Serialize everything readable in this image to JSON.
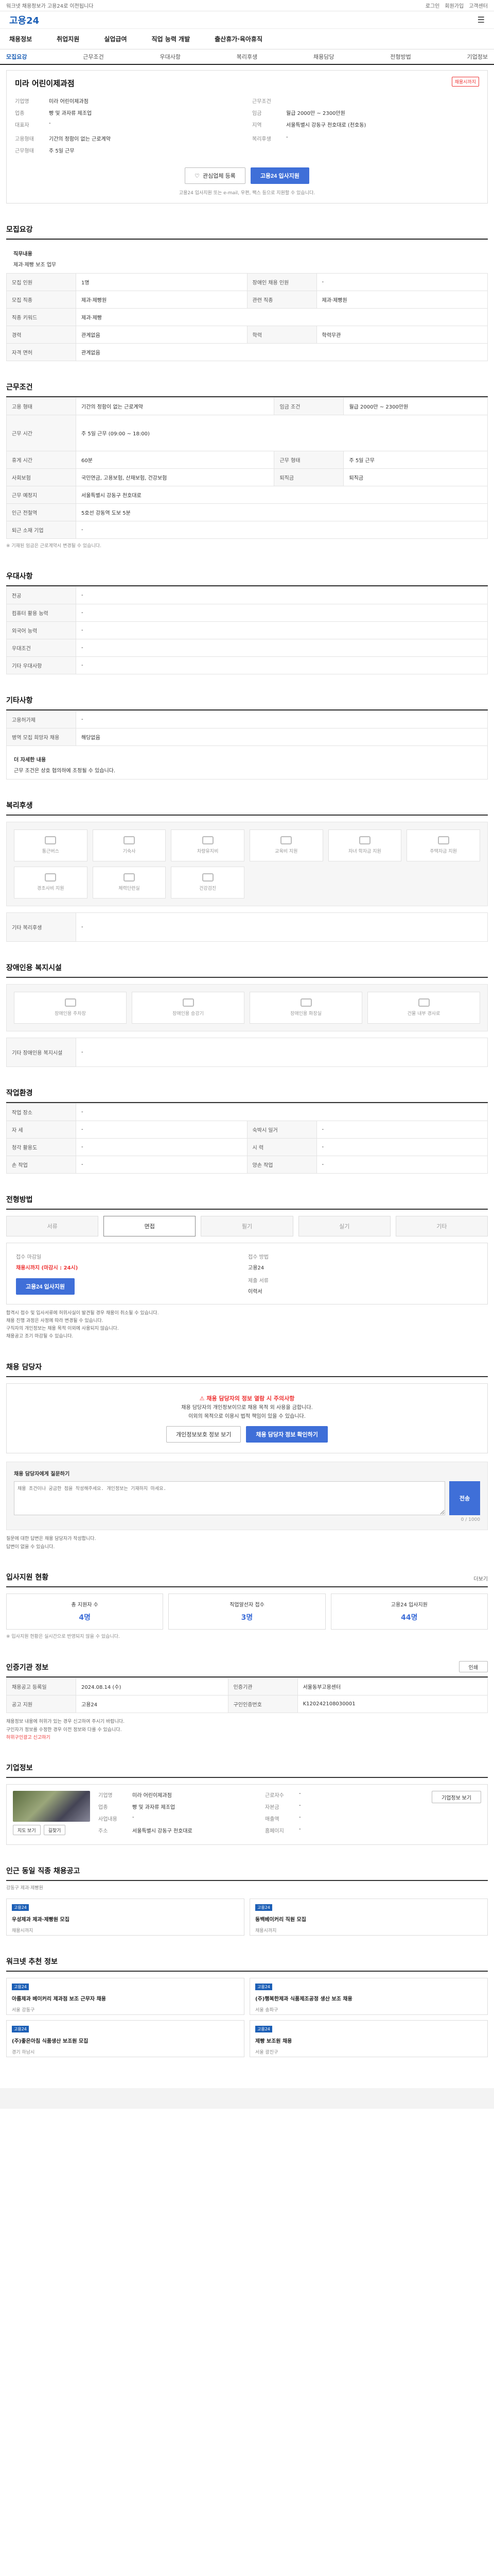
{
  "topbar": {
    "left": "워크넷 채용정보가 고용24로 이전됩니다",
    "links": [
      "로그인",
      "회원가입",
      "고객센터"
    ]
  },
  "logo": "고용24",
  "gnb": [
    "채용정보",
    "취업지원",
    "실업급여",
    "직업 능력 개발",
    "출산휴가·육아휴직"
  ],
  "subnav": {
    "items": [
      "모집요강",
      "근무조건",
      "우대사항",
      "복리후생",
      "채용담당",
      "전형방법",
      "기업정보"
    ],
    "active": 0
  },
  "job": {
    "title": "미라 어린이제과점",
    "badge": "채용시까지",
    "left_group": [
      {
        "k": "기업명",
        "v": "미라 어린이제과점"
      },
      {
        "k": "업종",
        "v": "빵 및 과자류 제조업"
      },
      {
        "k": "대표자",
        "v": "-"
      }
    ],
    "right_group": [
      {
        "k": "근무조건",
        "v": ""
      },
      {
        "k": "임금",
        "v": "월급 2000만 ~ 2300만원"
      },
      {
        "k": "지역",
        "v": "서울특별시 강동구 천호대로 (천호동)"
      }
    ],
    "left2": [
      {
        "k": "고용형태",
        "v": "기간의 정함이 없는 근로계약"
      },
      {
        "k": "근무형태",
        "v": "주 5일 근무"
      }
    ],
    "right2": [
      {
        "k": "복리후생",
        "v": "-"
      }
    ],
    "btn_scrap": "관심업체 등록",
    "btn_apply": "고용24 입사지원",
    "note": "고용24 입사지원 또는 e-mail, 우편, 팩스 등으로 지원할 수 있습니다."
  },
  "recruit": {
    "title": "모집요강",
    "job_title": "직무내용",
    "job_desc": "제과·제빵 보조 업무",
    "rows": [
      {
        "k1": "모집 인원",
        "v1": "1명",
        "k2": "장애인 채용 인원",
        "v2": "-"
      },
      {
        "k1": "모집 직종",
        "v1": "제과·제빵원",
        "k2": "관련 직종",
        "v2": "제과·제빵원"
      },
      {
        "k1": "직종 키워드",
        "v1": "제과·제빵",
        "k2": "",
        "v2": ""
      },
      {
        "k1": "경력",
        "v1": "관계없음",
        "k2": "학력",
        "v2": "학력무관"
      },
      {
        "k1": "자격 면허",
        "v1": "관계없음",
        "k2": "",
        "v2": ""
      }
    ]
  },
  "work": {
    "title": "근무조건",
    "rows": [
      {
        "k1": "고용 형태",
        "v1": "기간의 정함이 없는 근로계약",
        "k2": "임금 조건",
        "v2": "월급 2000만 ~ 2300만원"
      },
      {
        "k1": "근무 시간",
        "v1": "주 5일 근무 (09:00 ~ 18:00)",
        "k2": "",
        "v2": ""
      },
      {
        "k1": "휴게 시간",
        "v1": "60분",
        "k2": "근무 형태",
        "v2": "주 5일 근무"
      },
      {
        "k1": "사회보험",
        "v1": "국민연금, 고용보험, 산재보험, 건강보험",
        "k2": "퇴직금",
        "v2": "퇴직금"
      },
      {
        "k1": "근무 예정지",
        "v1": "서울특별시 강동구 천호대로",
        "k2": "",
        "v2": ""
      },
      {
        "k1": "인근 전철역",
        "v1": "5호선 강동역 도보 5분",
        "k2": "",
        "v2": ""
      },
      {
        "k1": "퇴근 소재 기업",
        "v1": "-",
        "k2": "",
        "v2": ""
      }
    ],
    "note": "※ 기재된 임금은 근로계약시 변경될 수 있습니다."
  },
  "prefer": {
    "title": "우대사항",
    "rows": [
      {
        "k": "전공",
        "v": "-"
      },
      {
        "k": "컴퓨터 활용 능력",
        "v": "-"
      },
      {
        "k": "외국어 능력",
        "v": "-"
      },
      {
        "k": "우대조건",
        "v": "-"
      },
      {
        "k": "기타 우대사항",
        "v": "-"
      }
    ]
  },
  "other": {
    "title": "기타사항",
    "rows": [
      {
        "k": "고용허가제",
        "v": "-"
      },
      {
        "k": "병역 모집 희망자 채용",
        "v": "해당없음"
      }
    ],
    "notice_title": "더 자세한 내용",
    "notice_desc": "근무 조건은 상호 협의하에 조정될 수 있습니다."
  },
  "welfare": {
    "title": "복리후생",
    "items": [
      "통근버스",
      "기숙사",
      "차량유지비",
      "교육비 지원",
      "자녀 학자금 지원",
      "주택자금 지원",
      "경조사비 지원",
      "체력단련실",
      "건강검진"
    ],
    "etc_label": "기타 복리후생",
    "etc_value": "-"
  },
  "disabled": {
    "title": "장애인용 복지시설",
    "items": [
      "장애인용 주차장",
      "장애인용 승강기",
      "장애인용 화장실",
      "건물 내부 경사로"
    ],
    "etc_label": "기타 장애인용 복지시설",
    "etc_value": "-"
  },
  "env": {
    "title": "작업환경",
    "rows": [
      {
        "k1": "작업 장소",
        "v1": "-",
        "k2": "",
        "v2": ""
      },
      {
        "k1": "자 세",
        "v1": "-",
        "k2": "숙박시 일거",
        "v2": "-"
      },
      {
        "k1": "청각 활용도",
        "v1": "-",
        "k2": "시 력",
        "v2": "-"
      },
      {
        "k1": "손 작업",
        "v1": "-",
        "k2": "양손 작업",
        "v2": "-"
      }
    ]
  },
  "screening": {
    "title": "전형방법",
    "steps": [
      "서류",
      "면접",
      "필기",
      "실기",
      "기타"
    ],
    "active": 1,
    "method_label": "접수 마감일",
    "method_value": "채용시까지 (마감시 : 24시)",
    "apply_label": "접수 방법",
    "apply_value": "고용24",
    "doc_label": "제출 서류",
    "doc_value": "이력서",
    "apply_btn": "고용24 입사지원",
    "bullets": [
      "합격시 접수 및 입사서류에 허위사실이 발견될 경우 채용이 취소될 수 있습니다.",
      "채용 진행 과정은 사정에 따라 변경될 수 있습니다.",
      "구직자의 개인정보는 채용 목적 이외에 사용되지 않습니다.",
      "채용공고 조기 마감될 수 있습니다."
    ]
  },
  "contact": {
    "title": "채용 담당자",
    "alert_title": "채용 담당자의 정보 열람 시 주의사항",
    "alert_lines": [
      "채용 담당자의 개인정보이므로 채용 목적 외 사용을 금합니다.",
      "이외의 목적으로 이용시 법적 책임이 있을 수 있습니다."
    ],
    "btn_view": "채용 담당자 정보 확인하기",
    "btn_report": "개인정보보호 정보 보기",
    "q_title": "채용 담당자에게 질문하기",
    "q_placeholder": "채용 조건이나 궁금한 점을 작성해주세요. 개인정보는 기재하지 마세요.",
    "q_count": "0 / 1000",
    "q_btn": "전송",
    "q_notes": [
      "질문에 대한 답변은 채용 담당자가 작성합니다.",
      "답변이 없을 수 있습니다."
    ]
  },
  "applicants": {
    "title": "입사지원 현황",
    "more": "더보기",
    "stats": [
      {
        "label": "총 지원자 수",
        "value": "4명"
      },
      {
        "label": "직업알선자 접수",
        "value": "3명"
      },
      {
        "label": "고용24 입사지원",
        "value": "44명"
      }
    ],
    "note": "※ 입사지원 현황은 실시간으로 반영되지 않을 수 있습니다."
  },
  "agency": {
    "title": "인증기관 정보",
    "print": "인쇄",
    "rows": [
      {
        "k1": "채용공고 등록일",
        "v1": "2024.08.14 (수)",
        "k2": "인증기관",
        "v2": "서울동부고용센터"
      },
      {
        "k1": "공고 지원",
        "v1": "고용24",
        "k2": "구인인증번호",
        "v2": "K120242108030001"
      }
    ],
    "notes": [
      "채용정보 내용에 허위가 있는 경우 신고하여 주시기 바랍니다.",
      "구인자가 정보를 수정한 경우 이전 정보와 다를 수 있습니다."
    ],
    "report": "허위구인광고 신고하기"
  },
  "company": {
    "title": "기업정보",
    "btn": "기업정보 보기",
    "rows": [
      {
        "k": "기업명",
        "v": "미라 어린이제과점"
      },
      {
        "k": "업종",
        "v": "빵 및 과자류 제조업"
      },
      {
        "k": "사업내용",
        "v": "-"
      },
      {
        "k": "주소",
        "v": "서울특별시 강동구 천호대로"
      }
    ],
    "rows2": [
      {
        "k": "근로자수",
        "v": "-"
      },
      {
        "k": "자본금",
        "v": "-"
      },
      {
        "k": "매출액",
        "v": "-"
      },
      {
        "k": "홈페이지",
        "v": "-"
      }
    ],
    "map_btns": [
      "지도 보기",
      "길찾기"
    ]
  },
  "similar": {
    "title": "인근 동일 직종 채용공고",
    "sub": "강동구 제과·제빵원",
    "jobs": [
      {
        "src": "고용24",
        "tt": "우성제과 제과·제빵원 모집",
        "bm": "채용시까지"
      },
      {
        "src": "고용24",
        "tt": "동백베이커리 직원 모집",
        "bm": "채용시까지"
      }
    ]
  },
  "recommend": {
    "title": "워크넷 추천 정보",
    "jobs": [
      {
        "src": "고용24",
        "tt": "아름제과 베이커리 제과점 보조 근무자 채용",
        "bm": "서울 강동구"
      },
      {
        "src": "고용24",
        "tt": "(주)행복한제과 식품제조공정 생산 보조 채용",
        "bm": "서울 송파구"
      },
      {
        "src": "고용24",
        "tt": "(주)좋은아침 식품생산 보조원 모집",
        "bm": "경기 하남시"
      },
      {
        "src": "고용24",
        "tt": "제빵 보조원 채용",
        "bm": "서울 광진구"
      }
    ]
  }
}
